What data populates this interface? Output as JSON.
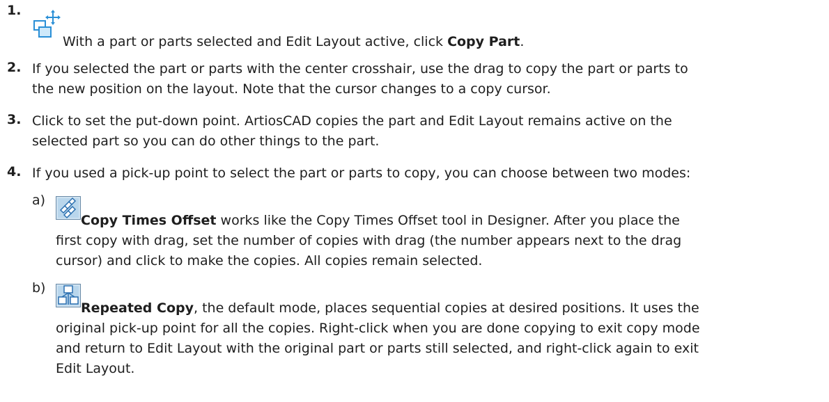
{
  "steps": [
    {
      "number": "1.",
      "icon": "copy-part-icon",
      "text_before": "With a part or parts selected and Edit Layout active, click ",
      "bold": "Copy Part",
      "text_after": "."
    },
    {
      "number": "2.",
      "lines": [
        "If you selected the part or parts with the center crosshair, use the drag to copy the part or parts to",
        "the new position on the layout. Note that the cursor changes to a copy cursor."
      ]
    },
    {
      "number": "3.",
      "lines": [
        "Click to set the put-down point. ArtiosCAD copies the part and Edit Layout remains active on the",
        "selected part so you can do other things to the part."
      ]
    },
    {
      "number": "4.",
      "lines": [
        "If you used a pick-up point to select the part or parts to copy, you can choose between two modes:"
      ]
    }
  ],
  "substeps": [
    {
      "label": "a)",
      "icon": "copy-times-offset-icon",
      "bold": "Copy Times Offset",
      "first_line_rest": " works like the Copy Times Offset tool in Designer. After you place the",
      "lines": [
        "first copy with drag, set the number of copies with drag (the number appears next to the drag",
        "cursor) and click to make the copies. All copies remain selected."
      ]
    },
    {
      "label": "b)",
      "icon": "repeated-copy-icon",
      "bold": "Repeated Copy",
      "first_line_rest": ", the default mode, places sequential copies at desired positions. It uses the",
      "lines": [
        "original pick-up point for all the copies. Right-click when you are done copying to exit copy mode",
        "and return to Edit Layout with the original part or parts still selected, and right-click again to exit",
        "Edit Layout."
      ]
    }
  ]
}
